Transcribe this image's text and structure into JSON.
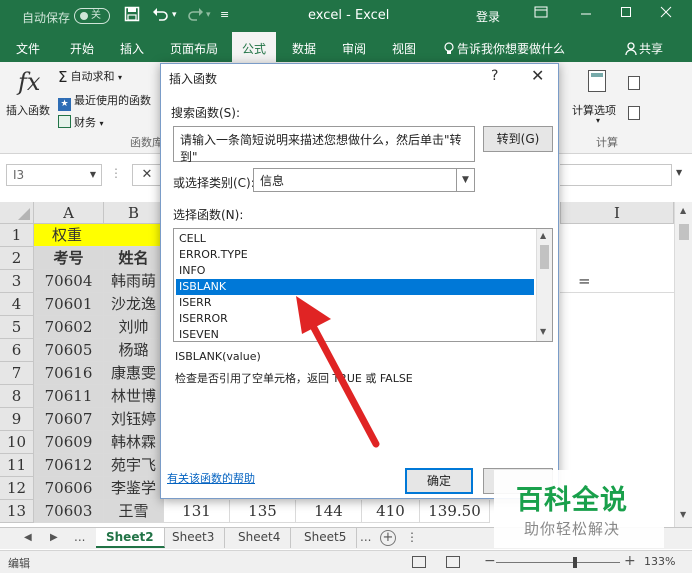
{
  "titlebar": {
    "autosave_label": "自动保存",
    "autosave_state": "关",
    "undo_icon": "undo-icon",
    "redo_icon": "redo-icon",
    "customize": "≡",
    "app_title": "excel  -  Excel",
    "login": "登录",
    "accent": "#217346"
  },
  "tabs": {
    "items": [
      "文件",
      "开始",
      "插入",
      "页面布局",
      "公式",
      "数据",
      "审阅",
      "视图"
    ],
    "active": "公式",
    "tellme": "告诉我你想要做什么",
    "share": "共享"
  },
  "ribbon": {
    "insert_function": "插入函数",
    "autosum": "自动求和",
    "recent": "最近使用的函数",
    "finance": "财务",
    "group_library": "函数库",
    "calc_options": "计算选项",
    "group_calc": "计算"
  },
  "formula_bar": {
    "name_box": "I3",
    "cancel": "✕"
  },
  "sheet": {
    "columns": [
      "A",
      "B",
      "I"
    ],
    "rows": [
      "1",
      "2",
      "3",
      "4",
      "5",
      "6",
      "7",
      "8",
      "9",
      "10",
      "11",
      "12",
      "13"
    ],
    "row1": "权重",
    "header": [
      "考号",
      "姓名"
    ],
    "data": [
      [
        "70604",
        "韩雨萌"
      ],
      [
        "70601",
        "沙龙逸"
      ],
      [
        "70602",
        "刘帅"
      ],
      [
        "70605",
        "杨璐"
      ],
      [
        "70616",
        "康惠雯"
      ],
      [
        "70611",
        "林世博"
      ],
      [
        "70607",
        "刘钰婷"
      ],
      [
        "70609",
        "韩林霖"
      ],
      [
        "70612",
        "苑宇飞"
      ],
      [
        "70606",
        "李鉴学"
      ],
      [
        "70603",
        "王雪"
      ]
    ],
    "row13_extra": [
      "131",
      "135",
      "144",
      "410",
      "139.50"
    ],
    "i3_value": "="
  },
  "sheet_tabs": {
    "items": [
      "Sheet2",
      "Sheet3",
      "Sheet4",
      "Sheet5"
    ],
    "active": "Sheet2",
    "more": "..."
  },
  "status": {
    "mode": "编辑",
    "zoom": "133%"
  },
  "dialog": {
    "title": "插入函数",
    "help": "?",
    "close": "✕",
    "search_label": "搜索函数(S):",
    "search_text": "请输入一条简短说明来描述您想做什么，然后单击\"转到\"",
    "goto": "转到(G)",
    "category_label": "或选择类别(C):",
    "category_value": "信息",
    "list_label": "选择函数(N):",
    "functions": [
      "CELL",
      "ERROR.TYPE",
      "INFO",
      "ISBLANK",
      "ISERR",
      "ISERROR",
      "ISEVEN"
    ],
    "selected": "ISBLANK",
    "signature": "ISBLANK(value)",
    "description": "检查是否引用了空单元格，返回 TRUE 或 FALSE",
    "help_link": "有关该函数的帮助",
    "ok": "确定",
    "selection_color": "#0078d7"
  },
  "watermark": {
    "title": "百科全说",
    "subtitle": "助你轻松解决"
  },
  "annotation_color": "#e02424"
}
